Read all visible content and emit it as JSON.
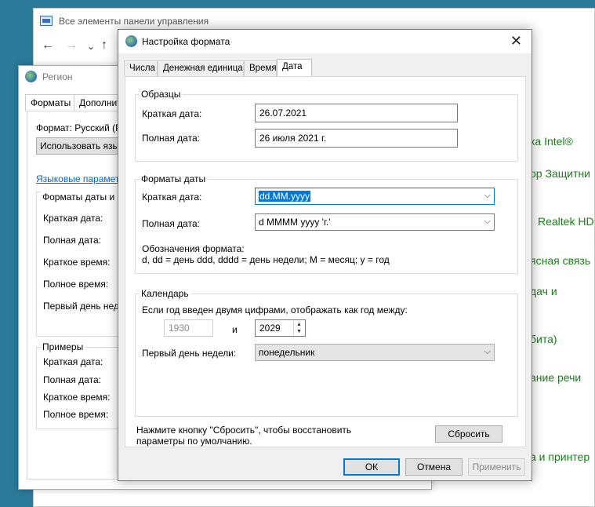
{
  "control_panel": {
    "title": "Все элементы панели управления",
    "nav": {
      "back": "←",
      "forward": "→",
      "dropdown": "⌄",
      "up": "↑"
    },
    "fragments": [
      "ка Intel®",
      "ор Защитни",
      "Realtek HD",
      "ясная связь",
      "дач и",
      "бита)",
      "ание речи",
      "а и принтер"
    ]
  },
  "region": {
    "title": "Регион",
    "tabs": [
      "Форматы",
      "Дополнит"
    ],
    "format_label": "Формат: Русский (Р",
    "use_lang_button": "Использовать язы",
    "lang_params_link": "Языковые парамет",
    "date_formats_group": "Форматы даты и в",
    "date_labels": [
      "Краткая дата:",
      "Полная дата:",
      "Краткое время:",
      "Полное время:",
      "Первый день неде"
    ],
    "examples_group": "Примеры",
    "example_labels": [
      "Краткая дата:",
      "Полная дата:",
      "Краткое время:",
      "Полное время:"
    ]
  },
  "dialog": {
    "title": "Настройка формата",
    "close": "✕",
    "tabs": [
      "Числа",
      "Денежная единица",
      "Время",
      "Дата"
    ],
    "samples": {
      "title": "Образцы",
      "short_label": "Краткая дата:",
      "short_value": "26.07.2021",
      "long_label": "Полная дата:",
      "long_value": "26 июля 2021 г."
    },
    "formats": {
      "title": "Форматы даты",
      "short_label": "Краткая дата:",
      "short_value": "dd.MM.yyyy",
      "long_label": "Полная дата:",
      "long_value": "d MMMM yyyy 'г.'",
      "notation_title": "Обозначения формата:",
      "notation_text": "d, dd = день  ddd, dddd = день недели; M = месяц; y = год"
    },
    "calendar": {
      "title": "Календарь",
      "two_digit_text": "Если год введен двумя цифрами, отображать как год между:",
      "year_from": "1930",
      "and_label": "и",
      "year_to": "2029",
      "first_day_label": "Первый день недели:",
      "first_day_value": "понедельник"
    },
    "reset_note_line1": "Нажмите кнопку \"Сбросить\", чтобы восстановить",
    "reset_note_line2": "параметры по умолчанию.",
    "reset_button": "Сбросить",
    "ok_button": "ОК",
    "cancel_button": "Отмена",
    "apply_button": "Применить"
  },
  "colors": {
    "accent": "#0078d7",
    "desktop": "#2b7a99",
    "link_green": "#1a7f1a"
  },
  "icons": [
    "control-panel-icon",
    "globe-icon",
    "close-icon",
    "chevron-down-icon",
    "spin-arrows-icon"
  ]
}
